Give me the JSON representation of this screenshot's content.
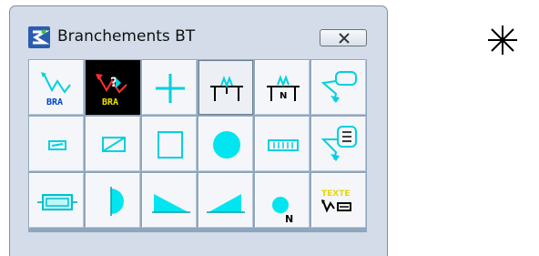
{
  "window": {
    "title": "Branchements BT",
    "close_icon": "close-x-icon",
    "app_icon": "app-logo-icon"
  },
  "palette": {
    "accent_cyan": "#00e5f0",
    "dark_tile": "#000000",
    "text_yellow": "#f0e000",
    "red": "#ff3030",
    "tools": [
      {
        "id": "branch-line",
        "icon": "zigzag-branch-icon",
        "label": "BRA"
      },
      {
        "id": "branch-query",
        "icon": "query-branch-icon",
        "label": "BRA"
      },
      {
        "id": "plus",
        "icon": "plus-icon"
      },
      {
        "id": "pole-span",
        "icon": "pole-span-icon"
      },
      {
        "id": "pole-span-n",
        "icon": "pole-span-n-icon",
        "label": "N"
      },
      {
        "id": "callout",
        "icon": "callout-arrow-icon"
      },
      {
        "id": "small-rect",
        "icon": "small-rect-icon"
      },
      {
        "id": "rect-diagonal",
        "icon": "rect-diagonal-icon"
      },
      {
        "id": "square",
        "icon": "square-icon"
      },
      {
        "id": "circle",
        "icon": "filled-circle-icon"
      },
      {
        "id": "grid-box",
        "icon": "grid-box-icon"
      },
      {
        "id": "callout-list",
        "icon": "callout-list-icon"
      },
      {
        "id": "boxed-rect",
        "icon": "boxed-rect-icon"
      },
      {
        "id": "half-circle",
        "icon": "half-circle-icon"
      },
      {
        "id": "triangle-left",
        "icon": "right-triangle-left-icon"
      },
      {
        "id": "triangle-right",
        "icon": "right-triangle-right-icon"
      },
      {
        "id": "circle-n",
        "icon": "circle-n-icon",
        "label": "N"
      },
      {
        "id": "texte",
        "icon": "texte-icon",
        "label": "TEXTE"
      }
    ]
  },
  "external": {
    "icon": "asterisk-cursor-icon"
  }
}
